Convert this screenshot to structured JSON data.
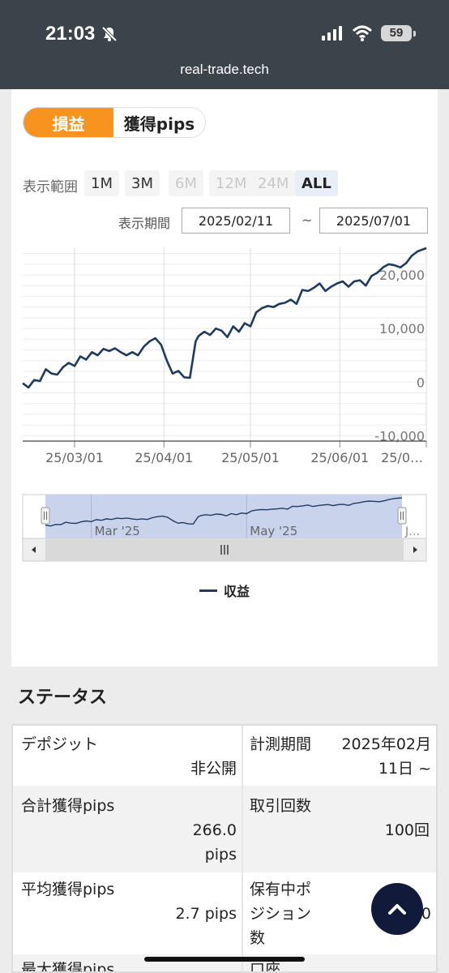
{
  "status_bar": {
    "time": "21:03",
    "battery": "59"
  },
  "browser": {
    "url": "real-trade.tech"
  },
  "chart_tabs": {
    "profit": "損益",
    "pips": "獲得pips"
  },
  "range": {
    "label": "表示範囲",
    "buttons": [
      "1M",
      "3M",
      "6M",
      "12M",
      "24M",
      "ALL"
    ],
    "selected": "ALL",
    "disabled": [
      "6M",
      "12M",
      "24M"
    ]
  },
  "period": {
    "label": "表示期間",
    "start": "2025/02/11",
    "separator": "~",
    "end": "2025/07/01"
  },
  "chart_data": {
    "type": "line",
    "title": "",
    "xlabel": "",
    "ylabel": "",
    "x_ticks": [
      "25/03/01",
      "25/04/01",
      "25/05/01",
      "25/06/01",
      "25/0…"
    ],
    "y_ticks": [
      "-10,000",
      "0",
      "10,000",
      "20,000"
    ],
    "ylim": [
      -11000,
      25000
    ],
    "legend": {
      "position": "bottom",
      "entries": [
        "収益"
      ]
    },
    "color": "#1f3b62",
    "series": [
      {
        "name": "収益",
        "x": [
          "2025-02-11",
          "2025-02-13",
          "2025-02-15",
          "2025-02-17",
          "2025-02-19",
          "2025-02-21",
          "2025-02-23",
          "2025-02-25",
          "2025-02-27",
          "2025-03-01",
          "2025-03-03",
          "2025-03-05",
          "2025-03-07",
          "2025-03-09",
          "2025-03-11",
          "2025-03-13",
          "2025-03-15",
          "2025-03-17",
          "2025-03-19",
          "2025-03-21",
          "2025-03-23",
          "2025-03-25",
          "2025-03-27",
          "2025-03-29",
          "2025-03-31",
          "2025-04-02",
          "2025-04-04",
          "2025-04-06",
          "2025-04-08",
          "2025-04-10",
          "2025-04-12",
          "2025-04-13",
          "2025-04-15",
          "2025-04-17",
          "2025-04-19",
          "2025-04-21",
          "2025-04-23",
          "2025-04-25",
          "2025-04-27",
          "2025-04-29",
          "2025-05-01",
          "2025-05-03",
          "2025-05-05",
          "2025-05-07",
          "2025-05-09",
          "2025-05-11",
          "2025-05-13",
          "2025-05-15",
          "2025-05-17",
          "2025-05-19",
          "2025-05-21",
          "2025-05-23",
          "2025-05-25",
          "2025-05-27",
          "2025-05-29",
          "2025-05-31",
          "2025-06-02",
          "2025-06-04",
          "2025-06-06",
          "2025-06-08",
          "2025-06-10",
          "2025-06-12",
          "2025-06-14",
          "2025-06-16",
          "2025-06-18",
          "2025-06-20",
          "2025-06-22",
          "2025-06-24",
          "2025-06-26",
          "2025-06-28",
          "2025-07-01"
        ],
        "values": [
          -200,
          -1000,
          400,
          200,
          2400,
          1600,
          1400,
          2800,
          3600,
          3000,
          4800,
          4200,
          5600,
          5000,
          6200,
          5800,
          6300,
          5600,
          5000,
          5600,
          5000,
          6600,
          7600,
          8200,
          7000,
          4000,
          1600,
          2100,
          900,
          800,
          7600,
          8600,
          9400,
          8800,
          10000,
          9600,
          8400,
          10400,
          9400,
          11000,
          10400,
          13000,
          13800,
          14200,
          14000,
          14600,
          14800,
          15400,
          14600,
          17200,
          17000,
          17600,
          18400,
          17000,
          17800,
          18400,
          18800,
          17800,
          18800,
          19000,
          18000,
          19800,
          20400,
          21400,
          22000,
          21800,
          21400,
          22200,
          23600,
          24400,
          25000
        ]
      }
    ]
  },
  "navigator": {
    "labels": [
      "Mar '25",
      "May '25",
      "J…"
    ]
  },
  "status": {
    "title": "ステータス",
    "rows": [
      {
        "l1": "デポジット",
        "v1": "非公開",
        "l2": "計測期間",
        "v2": "2025年02月11日 ~"
      },
      {
        "l1": "合計獲得pips",
        "v1": "266.0 pips",
        "l2": "取引回数",
        "v2": "100回"
      },
      {
        "l1": "平均獲得pips",
        "v1": "2.7 pips",
        "l2": "保有中ポジション数",
        "v2": "0"
      },
      {
        "l1": "最大獲得pips",
        "v1": "",
        "l2": "口座",
        "v2": ""
      }
    ]
  }
}
